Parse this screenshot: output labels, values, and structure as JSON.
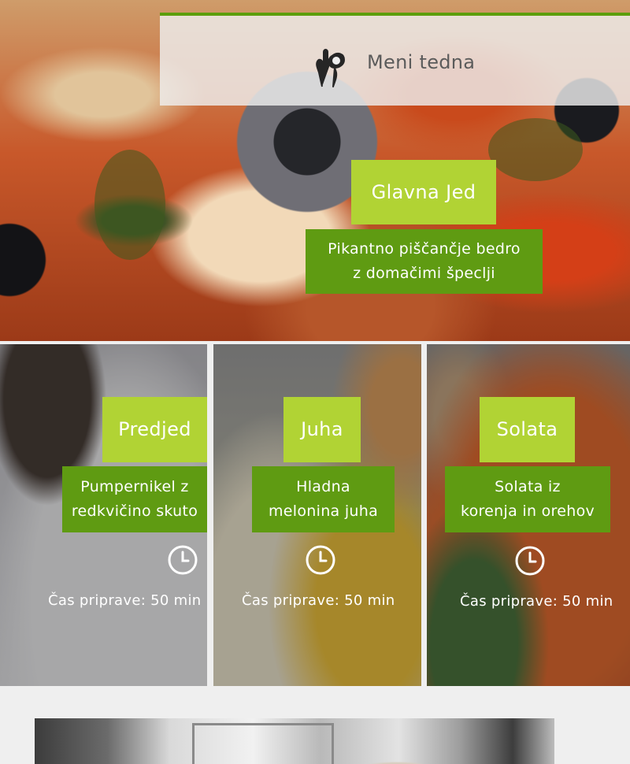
{
  "header": {
    "title": "Meni tedna",
    "icon": "ok-hand-icon"
  },
  "main_dish": {
    "heading": "Glavna Jed",
    "description_line1": "Pikantno piščančje bedro",
    "description_line2": "z domačimi špeclji"
  },
  "cards": [
    {
      "heading": "Predjed",
      "description_line1": "Pumpernikel z",
      "description_line2": "redkvičino skuto",
      "prep_time": "Čas priprave: 50 min"
    },
    {
      "heading": "Juha",
      "description_line1": "Hladna",
      "description_line2": "melonina juha",
      "prep_time": "Čas priprave: 50 min"
    },
    {
      "heading": "Solata",
      "description_line1": "Solata iz",
      "description_line2": "korenja in orehov",
      "prep_time": "Čas priprave: 50 min"
    }
  ],
  "colors": {
    "accent_light_green": "#b1d334",
    "accent_dark_green": "#5f9b12",
    "header_line": "#5c9e0c"
  }
}
